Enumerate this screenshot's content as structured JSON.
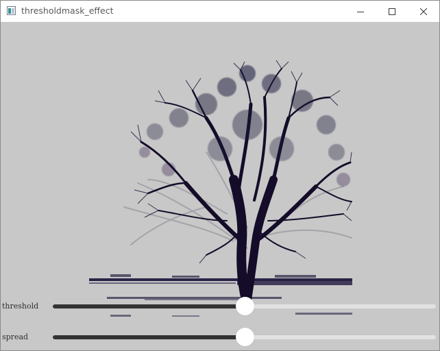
{
  "window": {
    "title": "thresholdmask_effect",
    "icon": "app-window-icon",
    "controls": [
      "minimize-icon",
      "maximize-icon",
      "close-icon"
    ]
  },
  "canvas": {
    "subject": "tree-silhouette",
    "background_color": "#c8c8c8",
    "ink_color": "#140c28"
  },
  "sliders": [
    {
      "label": "threshold",
      "value": 0.5
    },
    {
      "label": "spread",
      "value": 0.5
    }
  ],
  "colors": {
    "track": "#e2e2e2",
    "fill": "#333333",
    "thumb": "#ffffff"
  }
}
